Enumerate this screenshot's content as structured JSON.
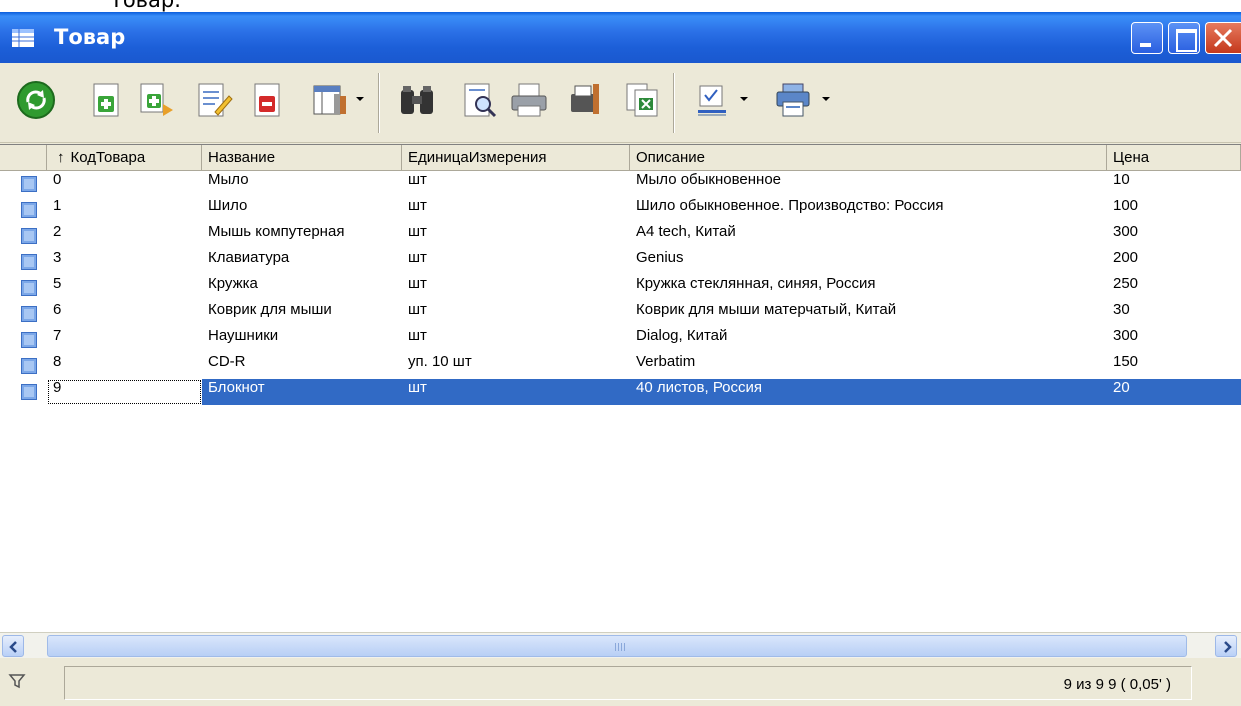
{
  "caption": "Товар.",
  "window": {
    "title": "Товар",
    "title_icon": "table-grid-icon",
    "controls": [
      "minimize",
      "maximize",
      "close"
    ]
  },
  "toolbar": {
    "buttons": [
      "refresh-icon",
      "new-record-icon",
      "copy-record-icon",
      "edit-record-icon",
      "delete-record-icon",
      "columns-settings-icon",
      "find-binoculars-icon",
      "preview-icon",
      "print-icon",
      "print-settings-icon",
      "export-excel-icon",
      "select-view-icon",
      "options-icon"
    ]
  },
  "grid": {
    "columns": [
      "КодТовара",
      "Название",
      "ЕдиницаИзмерения",
      "Описание",
      "Цена"
    ],
    "sort_indicator": "↑",
    "rows": [
      [
        "0",
        "Мыло",
        "шт",
        "Мыло обыкновенное",
        "10"
      ],
      [
        "1",
        "Шило",
        "шт",
        "Шило обыкновенное. Производство: Россия",
        "100"
      ],
      [
        "2",
        "Мышь компутерная",
        "шт",
        "A4 tech, Китай",
        "300"
      ],
      [
        "3",
        "Клавиатура",
        "шт",
        "Genius",
        "200"
      ],
      [
        "5",
        "Кружка",
        "шт",
        "Кружка стеклянная, синяя, Россия",
        "250"
      ],
      [
        "6",
        "Коврик для мыши",
        "шт",
        "Коврик для мыши матерчатый, Китай",
        "30"
      ],
      [
        "7",
        "Наушники",
        "шт",
        "Dialog, Китай",
        "300"
      ],
      [
        "8",
        "CD-R",
        "уп. 10 шт",
        "Verbatim",
        "150"
      ],
      [
        "9",
        "Блокнот",
        "шт",
        "40 листов, Россия",
        "20"
      ]
    ],
    "selected_row_index": 8
  },
  "statusbar": {
    "filter_icon": "filter-funnel-icon",
    "text": "9 из 9  9 ( 0,05' )"
  },
  "colors": {
    "titlebar": "#1c5fd8",
    "selection": "#316ac5",
    "chrome": "#ece9d8"
  }
}
